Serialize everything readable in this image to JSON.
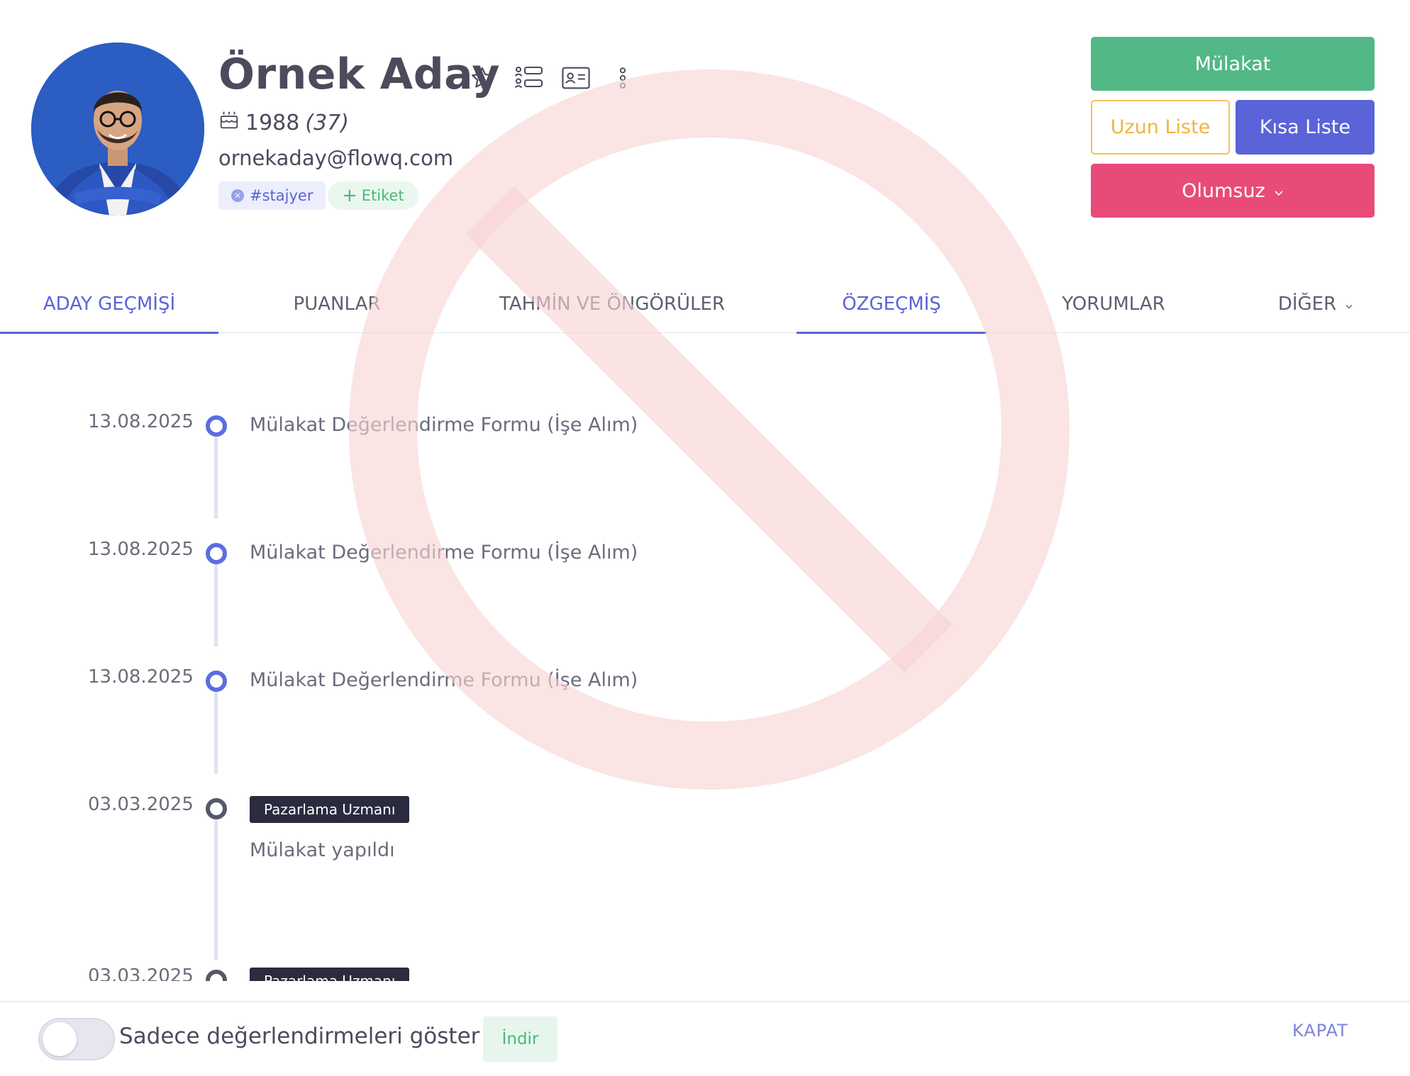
{
  "candidate": {
    "name": "Örnek Aday",
    "birth_year": "1988",
    "age": "(37)",
    "email": "ornekaday@flowq.com",
    "tag": "#stajyer",
    "add_tag_label": "Etiket"
  },
  "header_icons": [
    "star-icon",
    "list-users-icon",
    "id-card-icon",
    "more-vertical-icon"
  ],
  "actions": {
    "interview": "Mülakat",
    "long_list": "Uzun Liste",
    "short_list": "Kısa Liste",
    "reject": "Olumsuz"
  },
  "tabs": [
    {
      "label": "ADAY GEÇMİŞİ",
      "active": true
    },
    {
      "label": "PUANLAR",
      "active": false
    },
    {
      "label": "TAHMİN VE ÖNGÖRÜLER",
      "active": false
    },
    {
      "label": "ÖZGEÇMİŞ",
      "active": true
    },
    {
      "label": "YORUMLAR",
      "active": false
    },
    {
      "label": "DİĞER",
      "active": false
    }
  ],
  "timeline": [
    {
      "date": "13.08.2025",
      "text": "Mülakat Değerlendirme Formu (İşe Alım)",
      "dot": "blue"
    },
    {
      "date": "13.08.2025",
      "text": "Mülakat Değerlendirme Formu (İşe Alım)",
      "dot": "blue"
    },
    {
      "date": "13.08.2025",
      "text": "Mülakat Değerlendirme Formu (İşe Alım)",
      "dot": "blue"
    },
    {
      "date": "03.03.2025",
      "badge": "Pazarlama Uzmanı",
      "text": "Mülakat yapıldı",
      "dot": "dark"
    },
    {
      "date": "03.03.2025",
      "badge": "Pazarlama Uzmanı",
      "dot": "dark"
    }
  ],
  "footer": {
    "toggle_label": "Sadece değerlendirmeleri göster",
    "toggle_on": false,
    "download": "İndir",
    "close": "KAPAT"
  },
  "colors": {
    "primary": "#5a63d8",
    "success": "#52b886",
    "warning": "#f0b440",
    "danger": "#e94b78",
    "watermark": "#f8d3d3"
  }
}
